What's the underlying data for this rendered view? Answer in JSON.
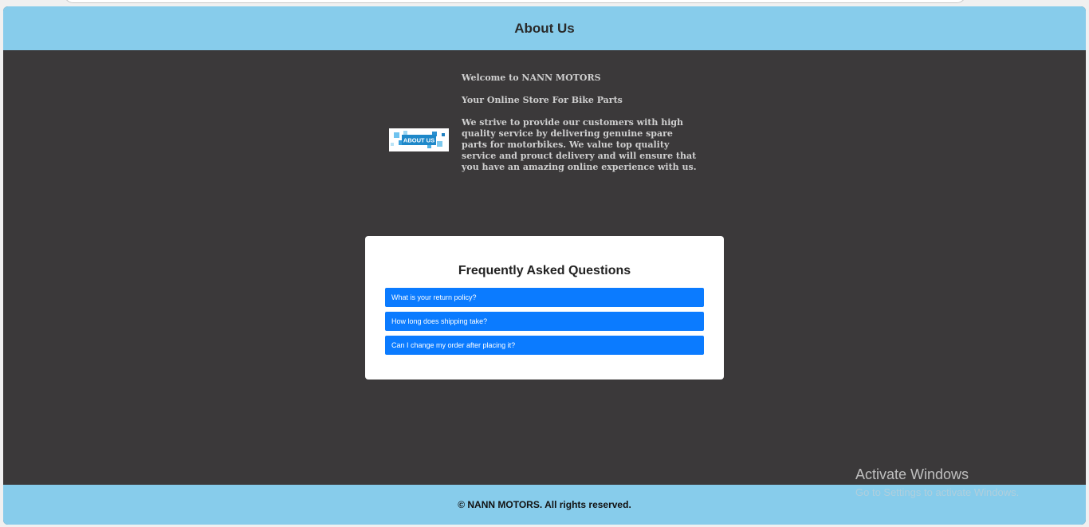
{
  "header": {
    "title": "About Us"
  },
  "about": {
    "image_text": "ABOUT US",
    "welcome": "Welcome to NANN MOTORS",
    "tagline": "Your Online Store For Bike Parts",
    "description": "We strive to provide our customers with high quality service by delivering genuine spare parts for motorbikes. We value top quality service and prouct delivery and will ensure that you have an amazing online experience with us."
  },
  "faq": {
    "title": "Frequently Asked Questions",
    "items": [
      {
        "question": "What is your return policy?"
      },
      {
        "question": "How long does shipping take?"
      },
      {
        "question": "Can I change my order after placing it?"
      }
    ]
  },
  "footer": {
    "copyright": "© NANN MOTORS. All rights reserved."
  },
  "watermark": {
    "line1": "Activate Windows",
    "line2": "Go to Settings to activate Windows."
  },
  "colors": {
    "header_bg": "#87cceb",
    "body_bg": "#3b393a",
    "faq_item_bg": "#0b7bff"
  }
}
